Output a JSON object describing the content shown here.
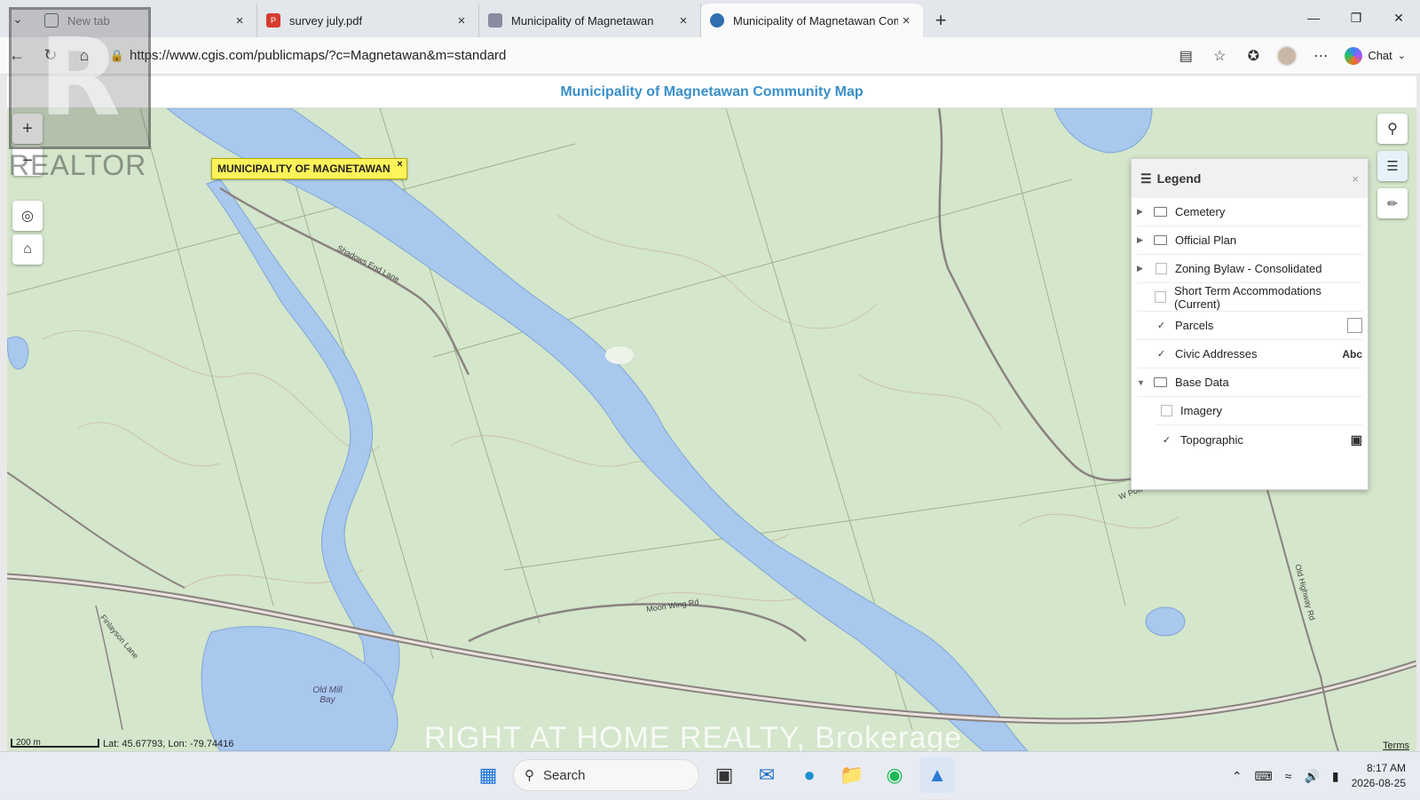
{
  "browser": {
    "tabs": [
      {
        "label": "New tab",
        "icon": "new-tab-icon",
        "active": false
      },
      {
        "label": "survey july.pdf",
        "icon": "pdf-icon",
        "active": false
      },
      {
        "label": "Municipality of Magnetawan",
        "icon": "site-icon",
        "active": false
      },
      {
        "label": "Municipality of Magnetawan Com",
        "icon": "cgis-icon",
        "active": true
      }
    ],
    "url": "https://www.cgis.com/publicmaps/?c=Magnetawan&m=standard",
    "chat_label": "Chat"
  },
  "page": {
    "title": "Municipality of Magnetawan Community Map"
  },
  "map": {
    "popup_label": "MUNICIPALITY OF MAGNETAWAN",
    "popup_close": "×",
    "scale_label": "200 m",
    "coords": "Lat: 45.67793, Lon: -79.74416",
    "terms": "Terms",
    "road_labels": [
      "Shadows End Lane",
      "Moon Wing Rd",
      "Finlayson Lane",
      "Old Highway Rd",
      "W Pow"
    ],
    "place_label": "Old Mill Bay"
  },
  "legend": {
    "title": "Legend",
    "close": "×",
    "items": [
      {
        "label": "Cemetery",
        "kind": "folder",
        "expand": "▶",
        "checked": null
      },
      {
        "label": "Official Plan",
        "kind": "folder",
        "expand": "▶",
        "checked": null
      },
      {
        "label": "Zoning Bylaw - Consolidated",
        "kind": "layer",
        "expand": "▶",
        "checked": false
      },
      {
        "label": "Short Term Accommodations (Current)",
        "kind": "layer",
        "expand": "",
        "checked": false
      },
      {
        "label": "Parcels",
        "kind": "layer",
        "expand": "",
        "checked": true,
        "extra": "swatch"
      },
      {
        "label": "Civic Addresses",
        "kind": "layer",
        "expand": "",
        "checked": true,
        "extra": "Abc"
      },
      {
        "label": "Base Data",
        "kind": "folder",
        "expand": "▼",
        "checked": null
      },
      {
        "label": "Imagery",
        "kind": "sublayer",
        "expand": "",
        "checked": false
      },
      {
        "label": "Topographic",
        "kind": "sublayer",
        "expand": "",
        "checked": true,
        "extra": "image"
      }
    ]
  },
  "watermark": {
    "brokerage": "RIGHT AT HOME REALTY, Brokerage",
    "logo_text": "REALTOR"
  },
  "taskbar": {
    "search_label": "Search",
    "time": "8:17 AM",
    "date": "2026-08-25"
  }
}
